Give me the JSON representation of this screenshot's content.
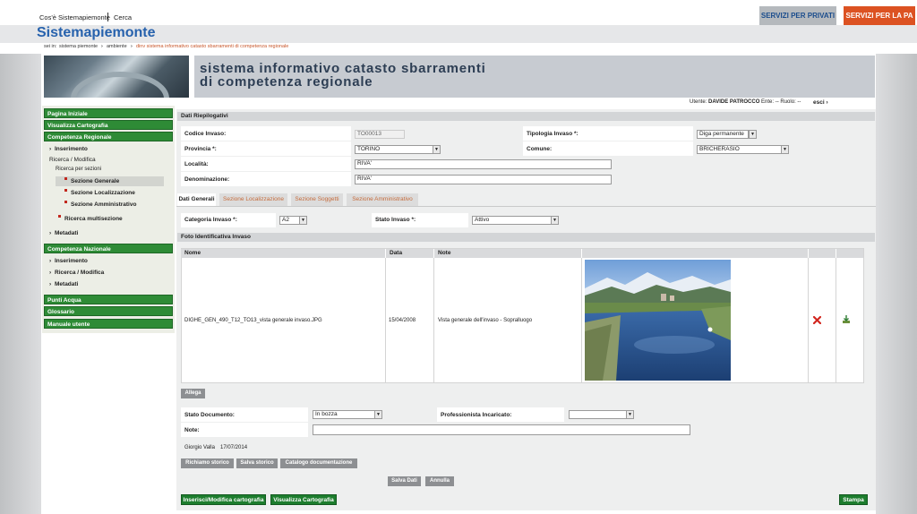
{
  "header": {
    "link_about": "Cos'è Sistemapiemonte",
    "link_search": "Cerca",
    "btn_privati": "SERVIZI PER PRIVATI",
    "btn_pa": "SERVIZI PER LA PA",
    "site_title": "Sistemapiemonte",
    "breadcrumb": {
      "prefix": "sei in:",
      "items": [
        "sistema piemonte",
        "ambiente",
        "dinv sistema informativo catasto sbarramenti di competenza regionale"
      ]
    }
  },
  "banner": {
    "line1": "sistema informativo catasto sbarramenti",
    "line2": "di competenza regionale"
  },
  "user": {
    "label": "Utente:",
    "name": "DAVIDE PATROCCO",
    "ente": "Ente: -- Ruolo: --",
    "logout": "esci"
  },
  "sidebar": {
    "pagina_iniziale": "Pagina Iniziale",
    "visualizza_cartografia": "Visualizza Cartografia",
    "competenza_regionale": "Competenza Regionale",
    "inserimento": "Inserimento",
    "ricerca_modifica": "Ricerca / Modifica",
    "ricerca_per_sezioni": "Ricerca per sezioni",
    "sezione_generale": "Sezione Generale",
    "sezione_localizzazione": "Sezione Localizzazione",
    "sezione_amministrativo": "Sezione Amministrativo",
    "ricerca_multisezione": "Ricerca multisezione",
    "metadati": "Metadati",
    "competenza_nazionale": "Competenza Nazionale",
    "naz_inserimento": "Inserimento",
    "naz_ricerca_modifica": "Ricerca / Modifica",
    "naz_metadati": "Metadati",
    "punti_acqua": "Punti Acqua",
    "glossario": "Glossario",
    "manuale_utente": "Manuale utente"
  },
  "riepilogo": {
    "title": "Dati Riepilogativi",
    "codice_label": "Codice Invaso:",
    "codice_value": "TO00013",
    "tipologia_label": "Tipologia Invaso *:",
    "tipologia_value": "Diga permanente",
    "provincia_label": "Provincia *:",
    "provincia_value": "TORINO",
    "comune_label": "Comune:",
    "comune_value": "BRICHERASIO",
    "localita_label": "Località:",
    "localita_value": "RIVA'",
    "denominazione_label": "Denominazione:",
    "denominazione_value": "RIVA'"
  },
  "tabs": [
    "Dati Generali",
    "Sezione Localizzazione",
    "Sezione Soggetti",
    "Sezione Amministrativo"
  ],
  "generali": {
    "categoria_label": "Categoria Invaso *:",
    "categoria_value": "A2",
    "stato_label": "Stato Invaso *:",
    "stato_value": "Attivo"
  },
  "foto": {
    "title": "Foto Identificativa Invaso",
    "col_nome": "Nome",
    "col_data": "Data",
    "col_note": "Note",
    "row": {
      "nome": "DIGHE_GEN_490_T12_TO13_vista generale invaso.JPG",
      "data": "15/04/2008",
      "note": "Vista generale dell'invaso - Sopralluogo"
    },
    "allega": "Allega"
  },
  "documento": {
    "stato_label": "Stato Documento:",
    "stato_value": "In bozza",
    "prof_label": "Professionista Incaricato:",
    "prof_value": "",
    "note_label": "Note:",
    "note_value": "",
    "author": "Giorgio Valla",
    "date": "17/07/2014"
  },
  "buttons": {
    "richiamo": "Richiamo storico",
    "salva_storico": "Salva storico",
    "catalogo": "Catalogo documentazione",
    "salva_dati": "Salva Dati",
    "annulla": "Annulla",
    "inserisci_cartografia": "Inserisci/Modifica cartografia",
    "visualizza_cartografia": "Visualizza Cartografia",
    "stampa": "Stampa"
  },
  "colors": {
    "brand_blue": "#2762ad",
    "pa_orange": "#dc5222",
    "nav_green": "#2e8b36",
    "tab_orange": "#c56b3b"
  }
}
